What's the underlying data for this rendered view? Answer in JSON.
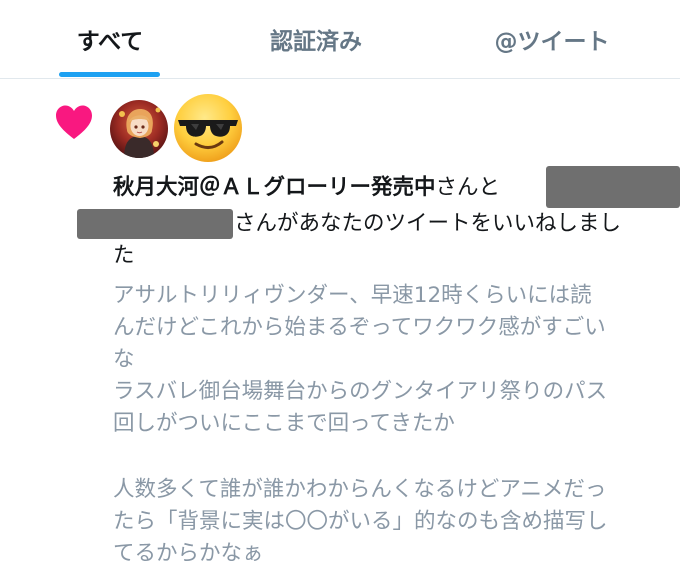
{
  "tabs": [
    {
      "label": "すべて",
      "active": true
    },
    {
      "label": "認証済み",
      "active": false
    },
    {
      "label": "@ツイート",
      "active": false
    }
  ],
  "notification": {
    "type_icon": "heart-icon",
    "accent_color": "#f91880",
    "user_name": "秋月大河＠ＡＬグローリー発売中",
    "text_after_name": "さんと",
    "text_line2": "さんがあなたのツイートをいいねしまし",
    "text_line3": "た",
    "tweet_lines": [
      "アサルトリリィヴンダー、早速12時くらいには読",
      "んだけどこれから始まるぞってワクワク感がすごい",
      "な",
      "ラスバレ御台場舞台からのグンタイアリ祭りのパス",
      "回しがついにここまで回ってきたか",
      "",
      "人数多くて誰が誰かわからんくなるけどアニメだっ",
      "たら「背景に実は〇〇がいる」的なのも含め描写し",
      "てるからかなぁ"
    ]
  },
  "colors": {
    "tab_accent": "#1da1f2",
    "tweet_text": "#8a98a6",
    "primary_text": "#14171a"
  }
}
